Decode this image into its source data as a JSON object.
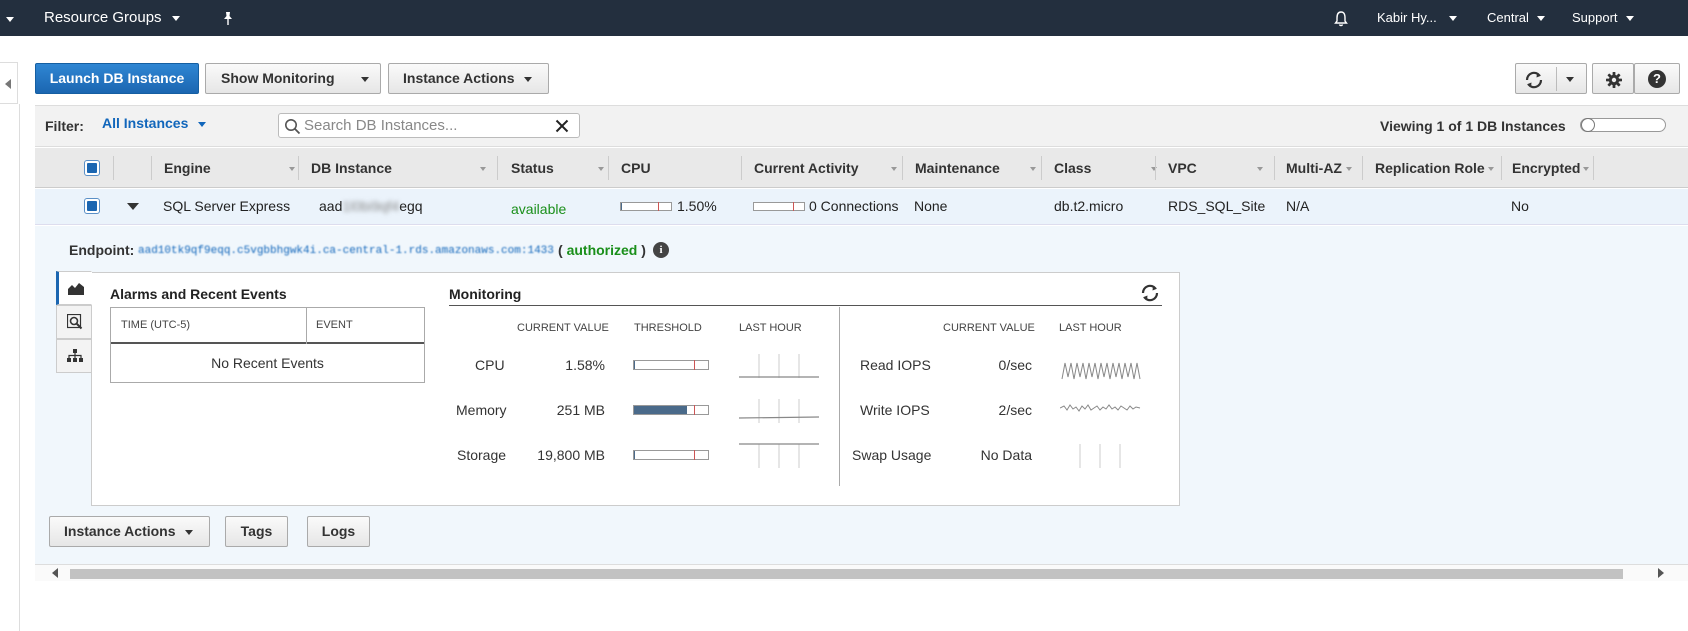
{
  "topnav": {
    "resource_groups": "Resource Groups",
    "user": "Kabir Hy...",
    "region": "Central",
    "support": "Support"
  },
  "toolbar": {
    "launch": "Launch DB Instance",
    "show_monitoring": "Show Monitoring",
    "instance_actions": "Instance Actions"
  },
  "filter": {
    "label": "Filter:",
    "value": "All Instances",
    "search_placeholder": "Search DB Instances...",
    "viewing": "Viewing 1 of 1 DB Instances"
  },
  "table": {
    "columns": [
      "Engine",
      "DB Instance",
      "Status",
      "CPU",
      "Current Activity",
      "Maintenance",
      "Class",
      "VPC",
      "Multi-AZ",
      "Replication Role",
      "Encrypted"
    ],
    "row": {
      "engine": "SQL Server Express",
      "db_instance_prefix": "aad",
      "db_instance_hidden": "1l0bi9qf4",
      "db_instance_suffix": "egq",
      "status": "available",
      "cpu": "1.50%",
      "cpu_fraction": 0.015,
      "activity": "0 Connections",
      "maintenance": "None",
      "class": "db.t2.micro",
      "vpc": "RDS_SQL_Site",
      "multi_az": "N/A",
      "replication_role": "",
      "encrypted": "No"
    }
  },
  "details": {
    "endpoint_label": "Endpoint:",
    "endpoint_url": "aad10tk9qf9eqq.c5vgbbhgwk4i.ca-central-1.rds.amazonaws.com:1433",
    "authorized_open": "(",
    "authorized": "authorized",
    "authorized_close": ")",
    "alarms_title": "Alarms and Recent Events",
    "time_col": "TIME (UTC-5)",
    "event_col": "EVENT",
    "no_events": "No Recent Events",
    "monitoring_title": "Monitoring",
    "hdr_current": "CURRENT VALUE",
    "hdr_threshold": "THRESHOLD",
    "hdr_last_hour": "LAST HOUR",
    "left_metrics": [
      {
        "label": "CPU",
        "value": "1.58%",
        "fill": 0.016
      },
      {
        "label": "Memory",
        "value": "251 MB",
        "fill": 0.72
      },
      {
        "label": "Storage",
        "value": "19,800 MB",
        "fill": 0.02
      }
    ],
    "right_metrics": [
      {
        "label": "Read IOPS",
        "value": "0/sec"
      },
      {
        "label": "Write IOPS",
        "value": "2/sec"
      },
      {
        "label": "Swap Usage",
        "value": "No Data"
      }
    ]
  },
  "bottom": {
    "instance_actions": "Instance Actions",
    "tags": "Tags",
    "logs": "Logs"
  }
}
